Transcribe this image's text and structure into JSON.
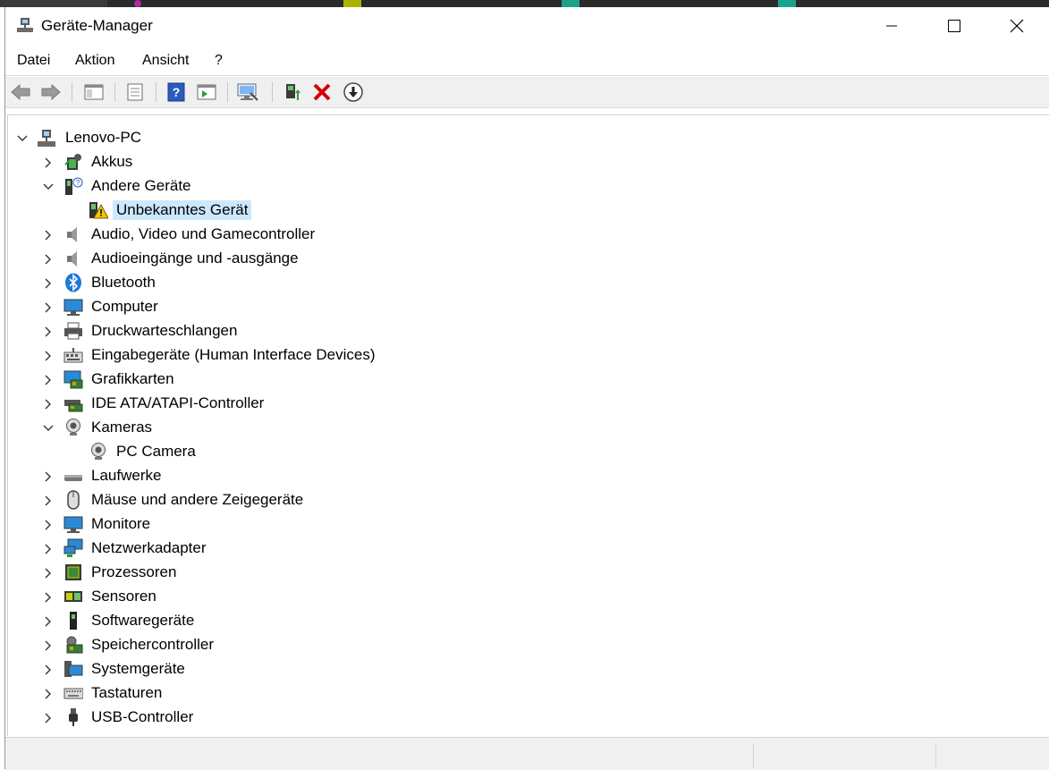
{
  "window": {
    "title": "Geräte-Manager",
    "accent": "#000000"
  },
  "menu": [
    "Datei",
    "Aktion",
    "Ansicht",
    "?"
  ],
  "toolbar": {
    "icons": [
      "back-arrow-icon",
      "forward-arrow-icon",
      "show-hide-console-tree-icon",
      "properties-icon",
      "help-icon",
      "action-pane-icon",
      "scan-hardware-icon",
      "update-driver-icon",
      "uninstall-icon",
      "disable-device-icon"
    ]
  },
  "tree": {
    "root": "Lenovo-PC",
    "nodes": [
      {
        "label": "Akkus",
        "icon": "battery-icon",
        "expanded": false
      },
      {
        "label": "Andere Geräte",
        "icon": "other-devices-icon",
        "expanded": true,
        "children": [
          "Unbekanntes Gerät"
        ]
      },
      {
        "label": "Audio, Video und Gamecontroller",
        "icon": "speaker-icon",
        "expanded": false
      },
      {
        "label": "Audioeingänge und -ausgänge",
        "icon": "speaker-icon",
        "expanded": false
      },
      {
        "label": "Bluetooth",
        "icon": "bluetooth-icon",
        "expanded": false
      },
      {
        "label": "Computer",
        "icon": "computer-icon",
        "expanded": false
      },
      {
        "label": "Druckwarteschlangen",
        "icon": "printer-icon",
        "expanded": false
      },
      {
        "label": "Eingabegeräte (Human Interface Devices)",
        "icon": "hid-icon",
        "expanded": false
      },
      {
        "label": "Grafikkarten",
        "icon": "display-adapter-icon",
        "expanded": false
      },
      {
        "label": "IDE ATA/ATAPI-Controller",
        "icon": "ide-controller-icon",
        "expanded": false
      },
      {
        "label": "Kameras",
        "icon": "camera-icon",
        "expanded": true,
        "children": [
          "PC Camera"
        ]
      },
      {
        "label": "Laufwerke",
        "icon": "disk-drive-icon",
        "expanded": false
      },
      {
        "label": "Mäuse und andere Zeigegeräte",
        "icon": "mouse-icon",
        "expanded": false
      },
      {
        "label": "Monitore",
        "icon": "monitor-icon",
        "expanded": false
      },
      {
        "label": "Netzwerkadapter",
        "icon": "network-adapter-icon",
        "expanded": false
      },
      {
        "label": "Prozessoren",
        "icon": "processor-icon",
        "expanded": false
      },
      {
        "label": "Sensoren",
        "icon": "sensor-icon",
        "expanded": false
      },
      {
        "label": "Softwaregeräte",
        "icon": "software-device-icon",
        "expanded": false
      },
      {
        "label": "Speichercontroller",
        "icon": "storage-controller-icon",
        "expanded": false
      },
      {
        "label": "Systemgeräte",
        "icon": "system-devices-icon",
        "expanded": false
      },
      {
        "label": "Tastaturen",
        "icon": "keyboard-icon",
        "expanded": false
      },
      {
        "label": "USB-Controller",
        "icon": "usb-icon",
        "expanded": false
      }
    ]
  },
  "colors": {
    "selection": "#cce8ff",
    "toolbar_bg": "#f0f0f0",
    "warning": "#f5c400",
    "error_red": "#d40000"
  }
}
